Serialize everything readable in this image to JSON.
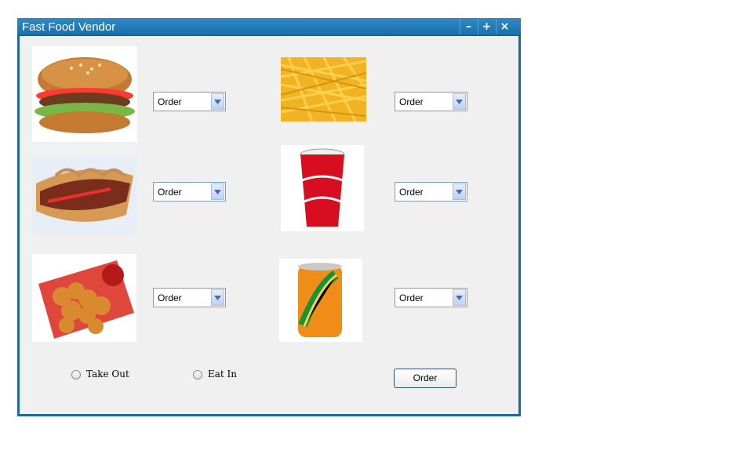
{
  "window": {
    "title": "Fast Food Vendor"
  },
  "items": [
    {
      "name": "burger",
      "dropdown_value": "Order"
    },
    {
      "name": "fries",
      "dropdown_value": "Order"
    },
    {
      "name": "hotdog",
      "dropdown_value": "Order"
    },
    {
      "name": "cola",
      "dropdown_value": "Order"
    },
    {
      "name": "chicken-nuggets",
      "dropdown_value": "Order"
    },
    {
      "name": "mirinda",
      "dropdown_value": "Order"
    }
  ],
  "options": {
    "take_out_label": "Take Out",
    "eat_in_label": "Eat In"
  },
  "actions": {
    "order_label": "Order"
  },
  "colors": {
    "title_bar": "#1a6fa9",
    "window_bg": "#f0f0f0",
    "frame": "#1b6a9e"
  }
}
